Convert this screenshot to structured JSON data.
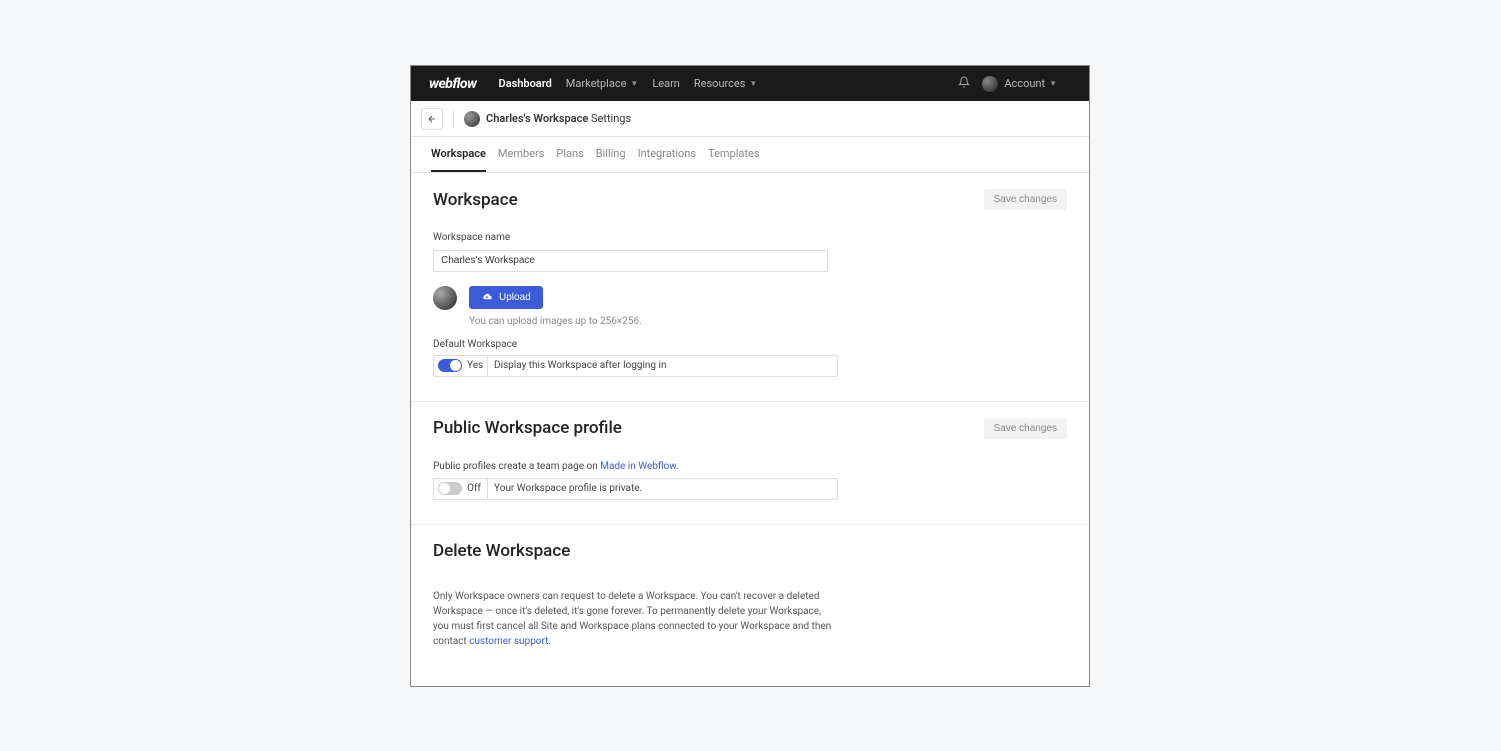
{
  "logo": "webflow",
  "nav": {
    "dashboard": "Dashboard",
    "marketplace": "Marketplace",
    "learn": "Learn",
    "resources": "Resources",
    "account": "Account"
  },
  "breadcrumb": {
    "workspace_name": "Charles's Workspace",
    "suffix": "Settings"
  },
  "tabs": {
    "workspace": "Workspace",
    "members": "Members",
    "plans": "Plans",
    "billing": "Billing",
    "integrations": "Integrations",
    "templates": "Templates"
  },
  "section1": {
    "title": "Workspace",
    "save": "Save changes",
    "name_label": "Workspace name",
    "name_value": "Charles's Workspace",
    "upload": "Upload",
    "upload_hint": "You can upload images up to 256×256.",
    "default_label": "Default Workspace",
    "toggle_state": "Yes",
    "toggle_desc": "Display this Workspace after logging in"
  },
  "section2": {
    "title": "Public Workspace profile",
    "save": "Save changes",
    "desc_prefix": "Public profiles create a team page on ",
    "desc_link": "Made in Webflow.",
    "toggle_state": "Off",
    "toggle_desc": "Your Workspace profile is private."
  },
  "section3": {
    "title": "Delete Workspace",
    "desc": "Only Workspace owners can request to delete a Workspace. You can't recover a deleted Workspace — once it's deleted, it's gone forever. To permanently delete your Workspace, you must first cancel all Site and Workspace plans connected to your Workspace and then contact ",
    "link": "customer support",
    "suffix": "."
  }
}
